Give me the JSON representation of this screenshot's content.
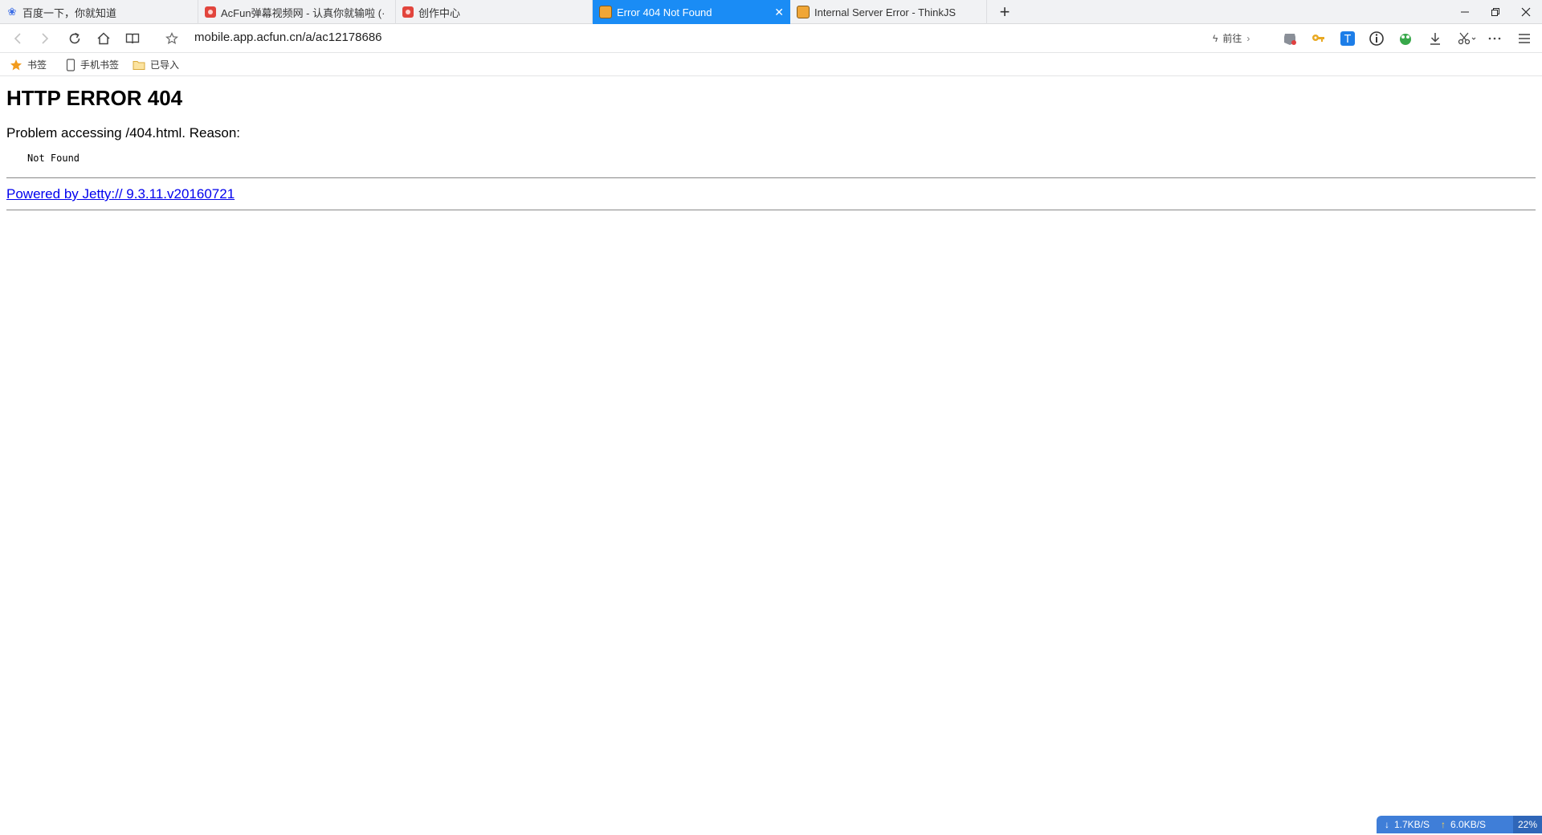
{
  "tabs": [
    {
      "title": "百度一下，你就知道",
      "favicon": "baidu-paw-icon",
      "active": false
    },
    {
      "title": "AcFun弹幕视频网 - 认真你就输啦 (·",
      "favicon": "acfun-icon",
      "active": false
    },
    {
      "title": "创作中心",
      "favicon": "acfun-icon",
      "active": false
    },
    {
      "title": "Error 404 Not Found",
      "favicon": "tiger-icon",
      "active": true
    },
    {
      "title": "Internal Server Error - ThinkJS",
      "favicon": "tiger-icon",
      "active": false
    }
  ],
  "navbar": {
    "url": "mobile.app.acfun.cn/a/ac12178686",
    "goto_label": "前往"
  },
  "bookmarks": [
    {
      "label": "书签",
      "icon": "star-icon"
    },
    {
      "label": "手机书签",
      "icon": "phone-icon"
    },
    {
      "label": "已导入",
      "icon": "folder-icon"
    }
  ],
  "page": {
    "heading": "HTTP ERROR 404",
    "problem": "Problem accessing /404.html. Reason:",
    "reason": "Not Found",
    "powered_link": "Powered by Jetty:// 9.3.11.v20160721"
  },
  "network": {
    "down_speed": "1.7KB/S",
    "up_speed": "6.0KB/S",
    "percent": "22%"
  },
  "colors": {
    "active_tab": "#1a8cf5",
    "link": "#0000ee",
    "net_widget": "#3f7ed8"
  }
}
